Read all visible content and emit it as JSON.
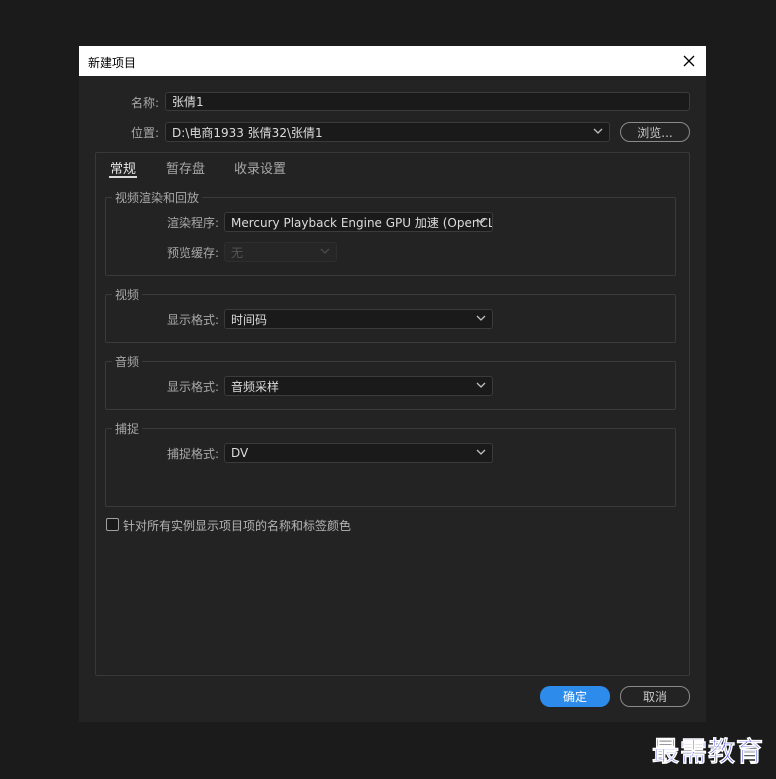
{
  "dialog": {
    "title": "新建项目"
  },
  "name_row": {
    "label": "名称:",
    "value": "张倩1"
  },
  "location_row": {
    "label": "位置:",
    "value": "D:\\电商1933 张倩32\\张倩1",
    "browse_label": "浏览..."
  },
  "tabs": [
    {
      "label": "常规",
      "active": true
    },
    {
      "label": "暂存盘",
      "active": false
    },
    {
      "label": "收录设置",
      "active": false
    }
  ],
  "video_render": {
    "title": "视频渲染和回放",
    "renderer_label": "渲染程序:",
    "renderer_value": "Mercury Playback Engine GPU 加速 (OpenCL)",
    "preview_cache_label": "预览缓存:",
    "preview_cache_value": "无"
  },
  "video": {
    "title": "视频",
    "format_label": "显示格式:",
    "format_value": "时间码"
  },
  "audio": {
    "title": "音频",
    "format_label": "显示格式:",
    "format_value": "音频采样"
  },
  "capture": {
    "title": "捕捉",
    "format_label": "捕捉格式:",
    "format_value": "DV"
  },
  "checkbox": {
    "label": "针对所有实例显示项目项的名称和标签颜色",
    "checked": false
  },
  "footer": {
    "ok_label": "确定",
    "cancel_label": "取消"
  },
  "watermark": "最需教育",
  "colors": {
    "accent": "#2d8ceb",
    "background": "#232323",
    "titlebar": "#ffffff"
  }
}
